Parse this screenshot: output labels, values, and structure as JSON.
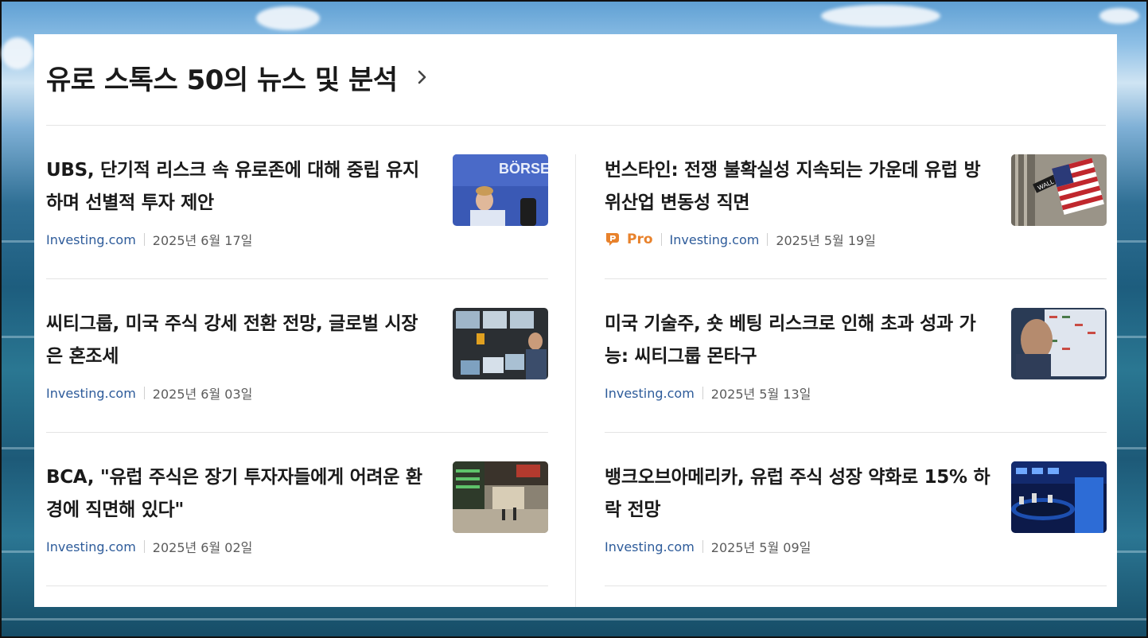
{
  "section": {
    "title": "유로 스톡스 50의 뉴스 및 분석"
  },
  "articles_left": [
    {
      "headline": "UBS, 단기적 리스크 속 유로존에 대해 중립 유지하며 선별적 투자 제안",
      "source": "Investing.com",
      "date": "2025년 6월 17일",
      "thumb_text": "BÖRSE"
    },
    {
      "headline": "씨티그룹, 미국 주식 강세 전환 전망, 글로벌 시장은 혼조세",
      "source": "Investing.com",
      "date": "2025년 6월 03일"
    },
    {
      "headline": "BCA, \"유럽 주식은 장기 투자자들에게 어려운 환경에 직면해 있다\"",
      "source": "Investing.com",
      "date": "2025년 6월 02일"
    }
  ],
  "articles_right": [
    {
      "headline": "번스타인: 전쟁 불확실성 지속되는 가운데 유럽 방위산업 변동성 직면",
      "pro_label": "Pro",
      "source": "Investing.com",
      "date": "2025년 5월 19일",
      "thumb_text": "WALL"
    },
    {
      "headline": "미국 기술주, 숏 베팅 리스크로 인해 초과 성과 가능: 씨티그룹 몬타구",
      "source": "Investing.com",
      "date": "2025년 5월 13일"
    },
    {
      "headline": "뱅크오브아메리카, 유럽 주식 성장 약화로 15% 하락 전망",
      "source": "Investing.com",
      "date": "2025년 5월 09일"
    }
  ],
  "icons": {
    "title_chevron": "chevron-right-icon",
    "pro_badge": "pro-badge-icon"
  },
  "colors": {
    "source_link": "#2d5b9a",
    "pro": "#e8822c",
    "text": "#1a1a1a",
    "date": "#5b5b5b"
  }
}
